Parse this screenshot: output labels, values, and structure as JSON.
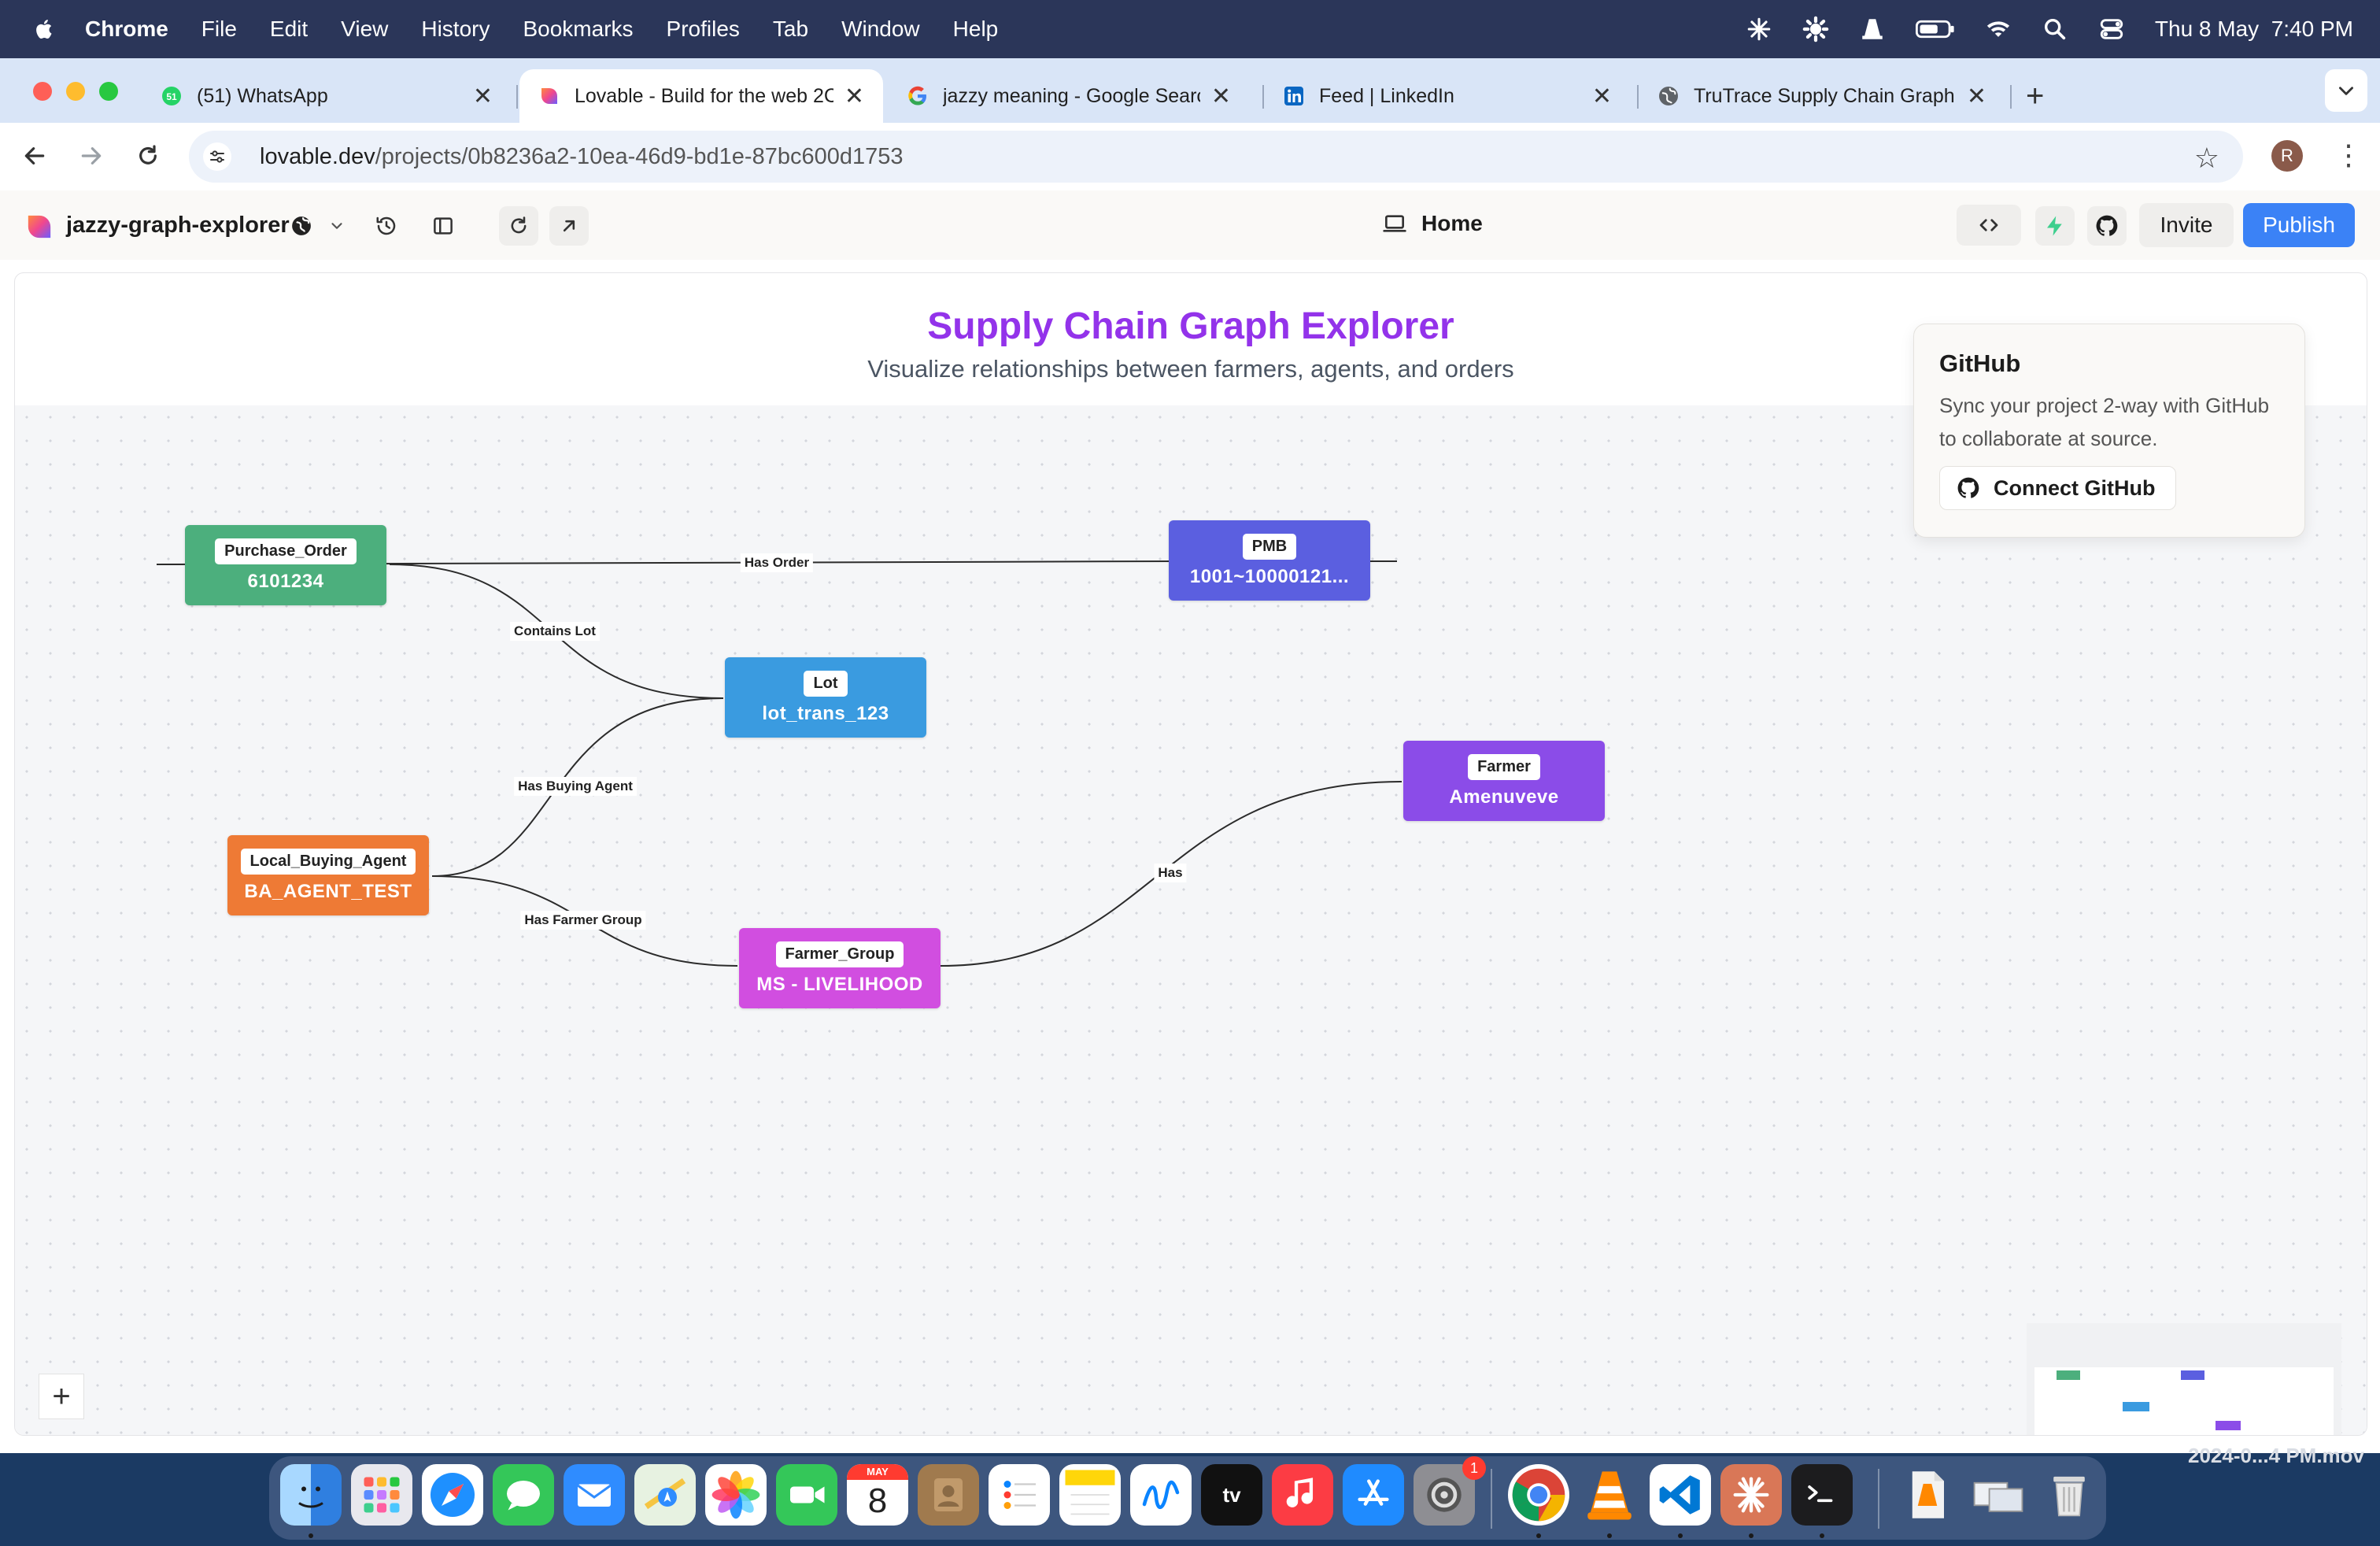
{
  "menubar": {
    "app": "Chrome",
    "menus": [
      "File",
      "Edit",
      "View",
      "History",
      "Bookmarks",
      "Profiles",
      "Tab",
      "Window",
      "Help"
    ],
    "clock": "Thu 8 May  7:40 PM"
  },
  "tabs": [
    {
      "title": "(51) WhatsApp",
      "icon": "whatsapp-icon",
      "badge": "51"
    },
    {
      "title": "Lovable - Build for the web 2C",
      "icon": "lovable-icon"
    },
    {
      "title": "jazzy meaning - Google Searc",
      "icon": "google-icon"
    },
    {
      "title": "Feed | LinkedIn",
      "icon": "linkedin-icon"
    },
    {
      "title": "TruTrace Supply Chain Graph",
      "icon": "globe-icon"
    }
  ],
  "address": {
    "host": "lovable.dev",
    "path": "/projects/0b8236a2-10ea-46d9-bd1e-87bc600d1753"
  },
  "profile_initial": "R",
  "lovable": {
    "project_name": "jazzy-graph-explorer",
    "page_label": "Home",
    "invite": "Invite",
    "publish": "Publish"
  },
  "app": {
    "title": "Supply Chain Graph Explorer",
    "subtitle": "Visualize relationships between farmers, agents, and orders"
  },
  "graph": {
    "nodes": [
      {
        "type": "Purchase_Order",
        "value": "6101234",
        "color": "#4caf7d"
      },
      {
        "type": "PMB",
        "value": "1001~10000121...",
        "color": "#5b5fe0"
      },
      {
        "type": "Lot",
        "value": "lot_trans_123",
        "color": "#3a9be0"
      },
      {
        "type": "Farmer",
        "value": "Amenuveve",
        "color": "#8b4ce8"
      },
      {
        "type": "Local_Buying_Agent",
        "value": "BA_AGENT_TEST",
        "color": "#ee7a35"
      },
      {
        "type": "Farmer_Group",
        "value": "MS - LIVELIHOOD",
        "color": "#d14ee0"
      }
    ],
    "edges": [
      {
        "from": "Purchase_Order",
        "to": "PMB",
        "label": "Has Order"
      },
      {
        "from": "Purchase_Order",
        "to": "Lot",
        "label": "Contains Lot"
      },
      {
        "from": "Local_Buying_Agent",
        "to": "Lot",
        "label": "Has Buying Agent"
      },
      {
        "from": "Local_Buying_Agent",
        "to": "Farmer_Group",
        "label": "Has Farmer Group"
      },
      {
        "from": "Farmer_Group",
        "to": "Farmer",
        "label": "Has"
      }
    ]
  },
  "github_popover": {
    "title": "GitHub",
    "description": "Sync your project 2-way with GitHub to collaborate at source.",
    "button": "Connect GitHub"
  },
  "zoom_in": "+",
  "dock": {
    "calendar_month": "MAY",
    "calendar_day": "8",
    "settings_badge": "1"
  },
  "desktop_file": "2024-0...4 PM.mov"
}
